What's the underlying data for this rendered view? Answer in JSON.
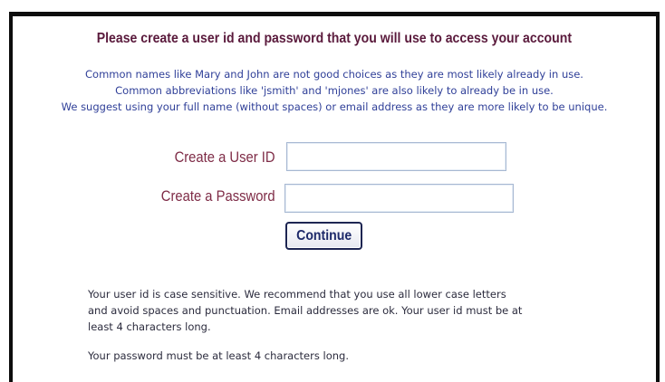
{
  "page": {
    "heading": "Please create a user id and password that you will use to access your account"
  },
  "notes": [
    "Common names like Mary and John are not good choices as they are most likely already in use.",
    "Common abbreviations like 'jsmith' and 'mjones' are also likely to already be in use.",
    "We suggest using your full name (without spaces) or email address as they are more likely to be unique."
  ],
  "form": {
    "user_id_label": "Create a User ID",
    "password_label": "Create a Password",
    "continue_label": "Continue"
  },
  "requirements": {
    "user_id_lines": [
      "Your user id is case sensitive. We recommend that you use all lower case letters",
      "and avoid spaces and punctuation. Email addresses are ok. Your user id must be at",
      "least 4 characters long."
    ],
    "password": "Your password must be at least 4 characters long."
  },
  "colors": {
    "title": "#5a1a3c",
    "label": "#7e2b46",
    "note": "#2f3f98",
    "rule": "#2b2b3d",
    "button_text": "#1e2a6a"
  }
}
